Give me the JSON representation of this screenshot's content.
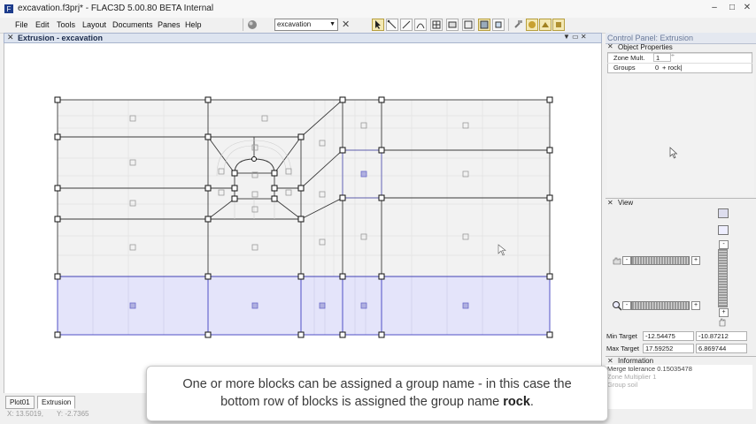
{
  "window": {
    "title": "excavation.f3prj* - FLAC3D 5.00.80 BETA Internal",
    "minimize": "–",
    "maximize": "□",
    "close": "✕"
  },
  "menu": [
    "File",
    "Edit",
    "Tools",
    "Layout",
    "Documents",
    "Panes",
    "Help"
  ],
  "toolbar": {
    "model_select": "excavation",
    "close_x": "✕",
    "icons": [
      "sphere-icon",
      "select-arrow-icon",
      "edge-tool-icon",
      "line-tool-icon",
      "curve-tool-icon",
      "grid-tool-icon",
      "block-tool-icon",
      "zone-tool-icon",
      "view-face-icon",
      "view-zone-icon",
      "box-icon",
      "hammer-icon",
      "tool-a-icon",
      "tool-b-icon",
      "tool-c-icon"
    ]
  },
  "left_pane": {
    "close": "✕",
    "title": "Extrusion - excavation",
    "controls": "▼  ▭  ✕"
  },
  "tabs": [
    "Plot01",
    "Extrusion"
  ],
  "status": {
    "x": "X: 13.5019,",
    "y": "Y: -2.7365"
  },
  "control_panel": {
    "title": "Control Panel: Extrusion",
    "object_properties": {
      "header": "Object Properties",
      "rows": [
        {
          "label": "Zone Mult.",
          "value": "1",
          "extra": "÷"
        },
        {
          "label": "Groups",
          "value": "0",
          "extra": "+ rock|"
        }
      ]
    },
    "view": {
      "header": "View",
      "min_target_label": "Min Target",
      "min_target_x": "-12.54475",
      "min_target_y": "-10.87212",
      "max_target_label": "Max Target",
      "max_target_x": "17.59252",
      "max_target_y": "6.869744"
    },
    "information": {
      "header": "Information",
      "lines": [
        "Merge tolerance  0.15035478",
        "Zone Multiplier  1",
        "Group  soil"
      ]
    }
  },
  "caption": {
    "line1": "One or more blocks can be assigned a group name - in this case the",
    "line2_prefix": "bottom row of blocks is assigned the group name ",
    "line2_bold": "rock",
    "line2_suffix": "."
  },
  "colors": {
    "rock_fill": "#e4e4fa",
    "rock_edge": "#4040c0",
    "soil_fill": "#f2f2f2",
    "block_edge": "#2a2a2a"
  }
}
